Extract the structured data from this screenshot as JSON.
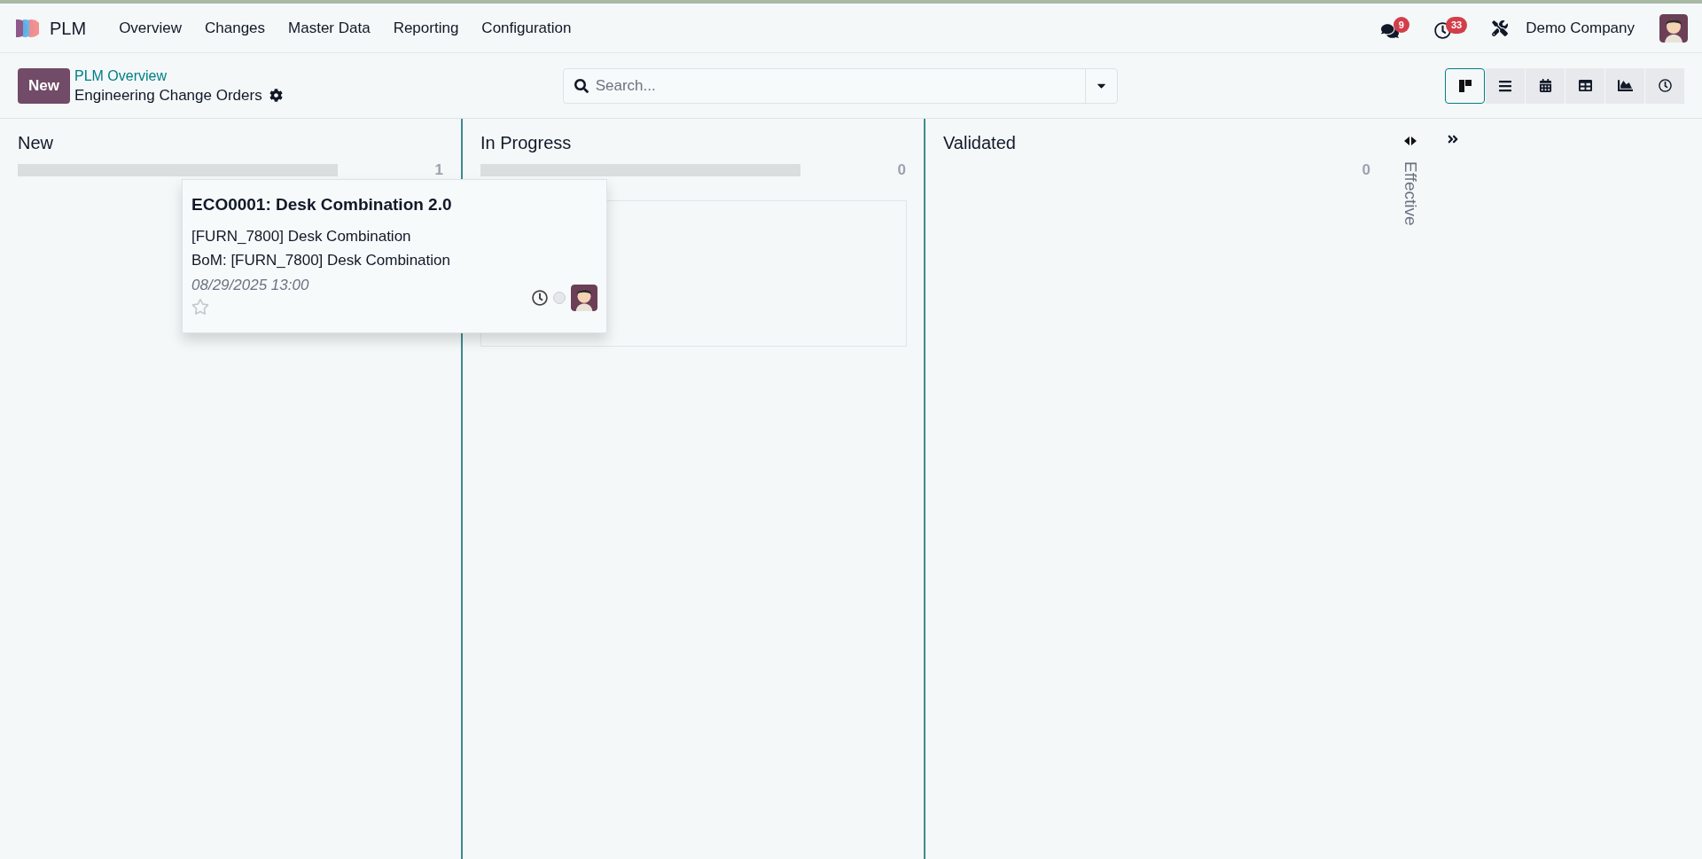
{
  "app": {
    "name": "PLM"
  },
  "menu": [
    "Overview",
    "Changes",
    "Master Data",
    "Reporting",
    "Configuration"
  ],
  "systray": {
    "messages_count": "9",
    "activities_count": "33",
    "company": "Demo Company"
  },
  "control_panel": {
    "new_button": "New",
    "breadcrumb": "PLM Overview",
    "title": "Engineering Change Orders",
    "search": {
      "placeholder": "Search..."
    },
    "views": [
      {
        "kind": "kanban",
        "selected": true
      },
      {
        "kind": "list",
        "selected": false
      },
      {
        "kind": "calendar",
        "selected": false
      },
      {
        "kind": "pivot",
        "selected": false
      },
      {
        "kind": "graph",
        "selected": false
      },
      {
        "kind": "activity",
        "selected": false
      }
    ]
  },
  "columns": [
    {
      "title": "New",
      "count": "1",
      "drop_target": false,
      "level": 0
    },
    {
      "title": "In Progress",
      "count": "0",
      "drop_target": true,
      "level": 0
    },
    {
      "title": "Validated",
      "count": "0",
      "drop_target": false
    }
  ],
  "folded_columns": [
    {
      "title": "Effective"
    }
  ],
  "dragged_card": {
    "title": "ECO0001: Desk Combination 2.0",
    "product": "[FURN_7800] Desk Combination",
    "bom": "BoM: [FURN_7800] Desk Combination",
    "date": "08/29/2025 13:00",
    "starred": false
  }
}
